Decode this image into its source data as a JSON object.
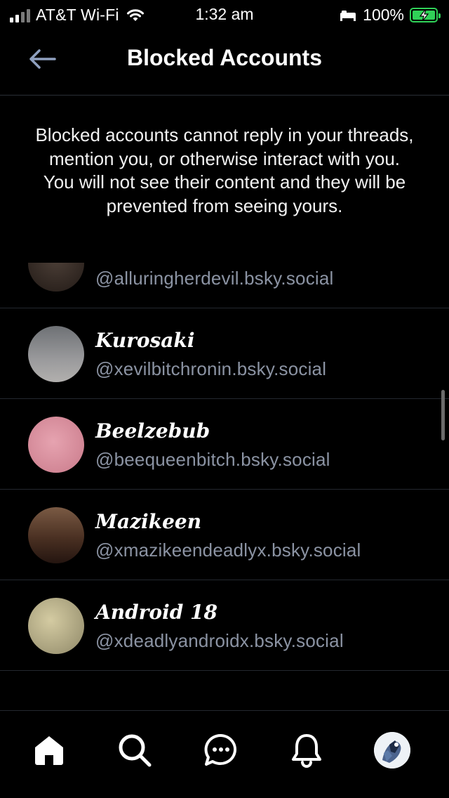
{
  "status_bar": {
    "carrier": "AT&T Wi-Fi",
    "time": "1:32 am",
    "battery": "100%",
    "battery_color": "#30d158"
  },
  "header": {
    "title": "Blocked Accounts",
    "back_icon": "arrow-left-icon"
  },
  "description": "Blocked accounts cannot reply in your threads, mention you, or otherwise interact with you. You will not see their content and they will be prevented from seeing yours.",
  "blocked_accounts": [
    {
      "name": "",
      "handle": "@alluringherdevil.bsky.social",
      "avatar_color": "#3a302a"
    },
    {
      "name": "Kurosaki",
      "handle": "@xevilbitchronin.bsky.social",
      "avatar_color": "#8e9094"
    },
    {
      "name": "Beelzebub",
      "handle": "@beequeenbitch.bsky.social",
      "avatar_color": "#d98a9a"
    },
    {
      "name": "Mazikeen",
      "handle": "@xmazikeendeadlyx.bsky.social",
      "avatar_color": "#5a3a28"
    },
    {
      "name": "Android 18",
      "handle": "@xdeadlyandroidx.bsky.social",
      "avatar_color": "#b9b08a"
    }
  ],
  "tab_bar": {
    "tabs": [
      {
        "icon": "home-icon"
      },
      {
        "icon": "search-icon"
      },
      {
        "icon": "chat-icon"
      },
      {
        "icon": "bell-icon"
      },
      {
        "icon": "profile-avatar"
      }
    ]
  },
  "colors": {
    "background": "#000000",
    "handle_text": "#8b93a3",
    "divider": "#24282f"
  }
}
